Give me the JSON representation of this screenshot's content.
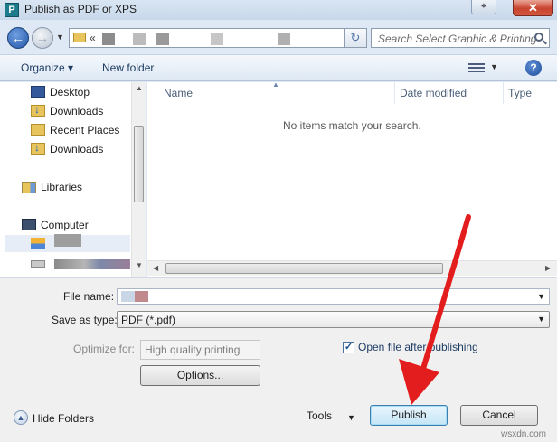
{
  "window": {
    "title": "Publish as PDF or XPS",
    "app_icon_letter": "P",
    "pin_glyph": "⌖",
    "close_glyph": "✕"
  },
  "address": {
    "back_glyph": "←",
    "forward_glyph": "→",
    "path_prefix": "«",
    "refresh_glyph": "↻"
  },
  "search": {
    "placeholder": "Search Select Graphic & Printing"
  },
  "command_bar": {
    "organize_label": "Organize ▾",
    "new_folder_label": "New folder",
    "help_glyph": "?"
  },
  "nav_pane": {
    "items": [
      {
        "label": "Desktop",
        "icon": "desktop-icon"
      },
      {
        "label": "Downloads",
        "icon": "downloads-folder-icon"
      },
      {
        "label": "Recent Places",
        "icon": "recent-places-icon"
      },
      {
        "label": "Downloads",
        "icon": "downloads-folder-icon"
      },
      {
        "label": "Libraries",
        "icon": "libraries-icon"
      },
      {
        "label": "Computer",
        "icon": "computer-icon"
      }
    ]
  },
  "file_list": {
    "columns": [
      "Name",
      "Date modified",
      "Type"
    ],
    "empty_message": "No items match your search."
  },
  "form": {
    "file_name_label": "File name:",
    "save_as_type_label": "Save as type:",
    "save_as_type_value": "PDF (*.pdf)",
    "optimize_label": "Optimize for:",
    "optimize_value": "High quality printing",
    "options_button": "Options...",
    "open_file_checkbox_label": "Open file after publishing",
    "open_file_checked": true,
    "hide_folders_label": "Hide Folders",
    "tools_label": "Tools",
    "publish_button": "Publish",
    "cancel_button": "Cancel"
  },
  "colors": {
    "annotation_arrow": "#e31d1d",
    "selection": "#e6edf6"
  },
  "watermark": "wsxdn.com"
}
